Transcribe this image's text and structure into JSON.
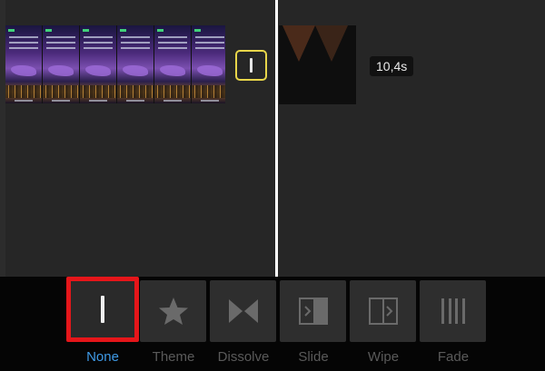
{
  "timeline": {
    "duration_label": "10,4s",
    "clip_frames": 6
  },
  "transitions": {
    "selected": "None",
    "items": [
      {
        "label": "None",
        "icon": "line-icon",
        "selected": true
      },
      {
        "label": "Theme",
        "icon": "star-icon",
        "selected": false
      },
      {
        "label": "Dissolve",
        "icon": "bowtie-icon",
        "selected": false
      },
      {
        "label": "Slide",
        "icon": "slide-icon",
        "selected": false
      },
      {
        "label": "Wipe",
        "icon": "wipe-icon",
        "selected": false
      },
      {
        "label": "Fade",
        "icon": "bars-icon",
        "selected": false
      }
    ]
  },
  "colors": {
    "selection_border": "#e5161a",
    "selected_label": "#3f9ae6",
    "transition_marker": "#e8d64a"
  }
}
